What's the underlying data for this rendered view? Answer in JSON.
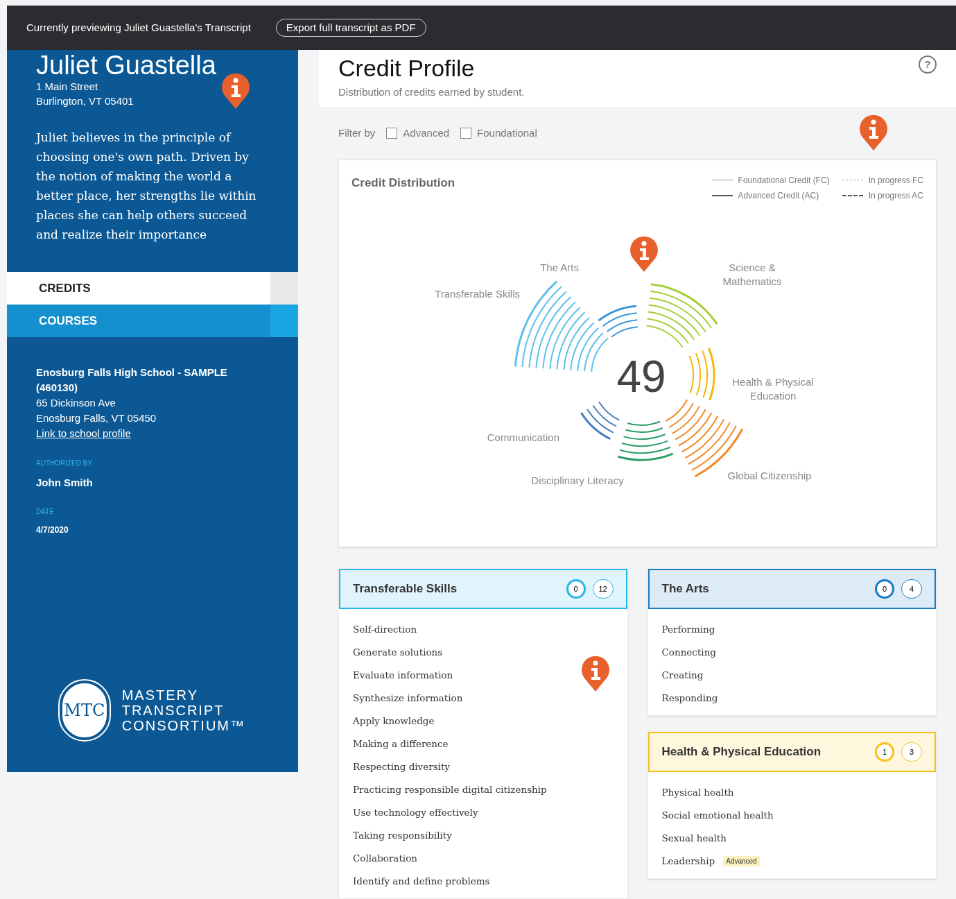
{
  "top_bar": {
    "preview_text": "Currently previewing Juliet Guastella's Transcript",
    "export_button": "Export full transcript as PDF"
  },
  "student": {
    "name": "Juliet Guastella",
    "address": [
      "1 Main Street",
      "Burlington, VT 05401"
    ],
    "bio": "Juliet believes in the principle of choosing one's own path. Driven by the notion of making the world a better place, her strengths lie within places she can help others succeed and realize their importance"
  },
  "nav_tabs": [
    {
      "label": "CREDITS",
      "selected": true
    },
    {
      "label": "COURSES",
      "selected": false
    }
  ],
  "school": {
    "lines": [
      "Enosburg Falls High School - SAMPLE (460130)",
      "65 Dickinson Ave",
      "Enosburg Falls, VT 05450"
    ],
    "link": "Link to school profile",
    "authorized_label": "AUTHORIZED BY",
    "authorized_by": "John Smith",
    "date_label": "DATE",
    "date": "4/7/2020"
  },
  "logo": {
    "mark": "MTC",
    "lines": [
      "MASTERY",
      "TRANSCRIPT",
      "CONSORTIUM™"
    ]
  },
  "header": {
    "title": "Credit Profile",
    "subtitle": "Distribution of credits earned by student.",
    "help": "?"
  },
  "filter": {
    "label": "Filter by",
    "options": [
      {
        "label": "Advanced",
        "checked": false
      },
      {
        "label": "Foundational",
        "checked": false
      }
    ]
  },
  "chart_panel": {
    "title": "Credit Distribution",
    "legend": [
      {
        "label": "Foundational Credit (FC)",
        "kind": "thin"
      },
      {
        "label": "Advanced Credit (AC)",
        "kind": "thick"
      },
      {
        "label": "In progress FC",
        "kind": "thin-dashed"
      },
      {
        "label": "In progress AC",
        "kind": "thick-dashed"
      }
    ],
    "total": "49",
    "segments": [
      {
        "label": "The Arts",
        "color": "#3a9ad9"
      },
      {
        "label": "Science & Mathematics",
        "color": "#a6cf3a"
      },
      {
        "label": "Health & Physical Education",
        "color": "#f5b800"
      },
      {
        "label": "Global Citizenship",
        "color": "#f08a24"
      },
      {
        "label": "Disciplinary Literacy",
        "color": "#2e9e6a"
      },
      {
        "label": "Communication",
        "color": "#4a7fbf"
      },
      {
        "label": "Transferable Skills",
        "color": "#5cc0ec"
      }
    ]
  },
  "cards": [
    {
      "title": "Transferable Skills",
      "color": "#29b6e8",
      "earned": "0",
      "total": "12",
      "items": [
        {
          "label": "Self-direction"
        },
        {
          "label": "Generate solutions"
        },
        {
          "label": "Evaluate information"
        },
        {
          "label": "Synthesize information"
        },
        {
          "label": "Apply knowledge"
        },
        {
          "label": "Making a difference"
        },
        {
          "label": "Respecting diversity"
        },
        {
          "label": "Practicing responsible digital citizenship"
        },
        {
          "label": "Use technology effectively"
        },
        {
          "label": "Taking responsibility"
        },
        {
          "label": "Collaboration"
        },
        {
          "label": "Identify and define problems"
        }
      ]
    },
    {
      "title": "The Arts",
      "color": "#1a7cc0",
      "earned": "0",
      "total": "4",
      "items": [
        {
          "label": "Performing"
        },
        {
          "label": "Connecting"
        },
        {
          "label": "Creating"
        },
        {
          "label": "Responding"
        }
      ]
    },
    {
      "title": "Health & Physical Education",
      "color": "#f5c11a",
      "earned": "1",
      "total": "3",
      "items": [
        {
          "label": "Physical health"
        },
        {
          "label": "Social emotional health"
        },
        {
          "label": "Sexual health"
        },
        {
          "label": "Leadership",
          "badge": "Advanced"
        }
      ]
    }
  ]
}
